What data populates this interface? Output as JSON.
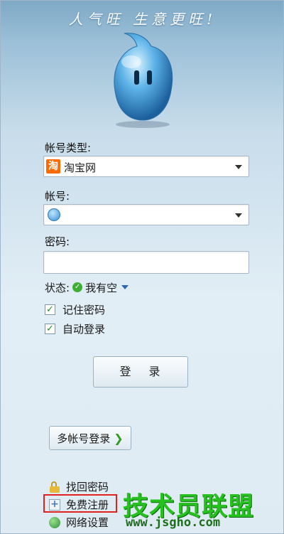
{
  "slogan": "人气旺  生意更旺!",
  "account_type": {
    "label": "帐号类型:",
    "value": "淘宝网",
    "icon": "taobao-icon"
  },
  "account": {
    "label": "帐号:",
    "value": ""
  },
  "password": {
    "label": "密码:",
    "value": ""
  },
  "status": {
    "label": "状态:",
    "value": "我有空"
  },
  "options": [
    {
      "label": "记住密码",
      "checked": true
    },
    {
      "label": "自动登录",
      "checked": true
    }
  ],
  "login_button": "登 录",
  "multi_account_button": "多帐号登录",
  "links": {
    "recover_password": "找回密码",
    "free_register": "免费注册",
    "network_settings": "网络设置"
  },
  "watermark": {
    "text": "技术员联盟",
    "url": "www.jsgho.com"
  },
  "colors": {
    "accent": "#2f9a25",
    "highlight": "#e32121",
    "watermark": "#27c11f"
  }
}
